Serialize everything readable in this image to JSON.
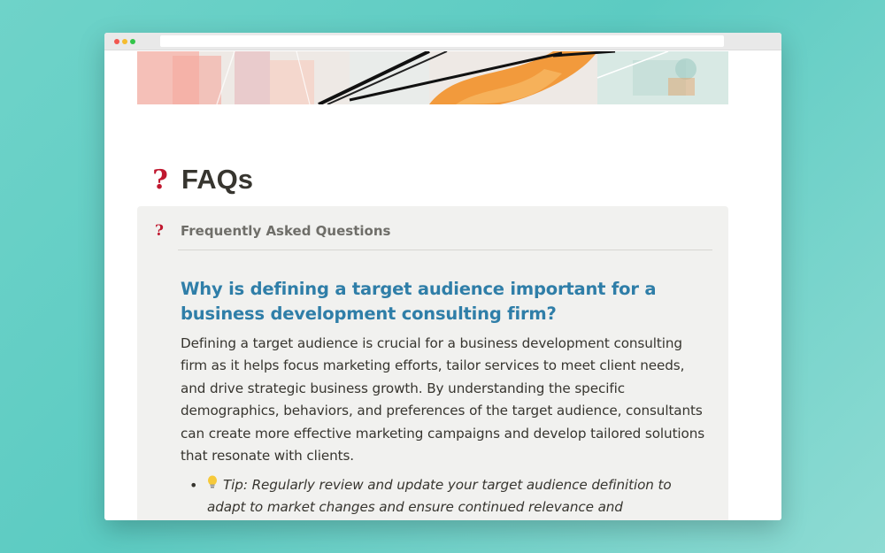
{
  "page": {
    "title": "FAQs",
    "icon": "question-mark-icon"
  },
  "callout": {
    "icon": "question-mark-icon",
    "title": "Frequently Asked Questions"
  },
  "faq": {
    "question": "Why is defining a target audience important for a business development consulting firm?",
    "answer": "Defining a target audience is crucial for a business development consulting firm as it helps focus marketing efforts, tailor services to meet client needs, and drive strategic business growth. By understanding the specific demographics, behaviors, and preferences of the target audience, consultants can create more effective marketing campaigns and develop tailored solutions that resonate with clients.",
    "tip_icon": "lightbulb-icon",
    "tip": "Tip: Regularly review and update your target audience definition to adapt to market changes and ensure continued relevance and effectiveness."
  },
  "colors": {
    "question_accent": "#2f7ea8",
    "icon_red": "#c0182f",
    "callout_bg": "#f1f1ef",
    "page_bg": "#5ccbc2"
  }
}
